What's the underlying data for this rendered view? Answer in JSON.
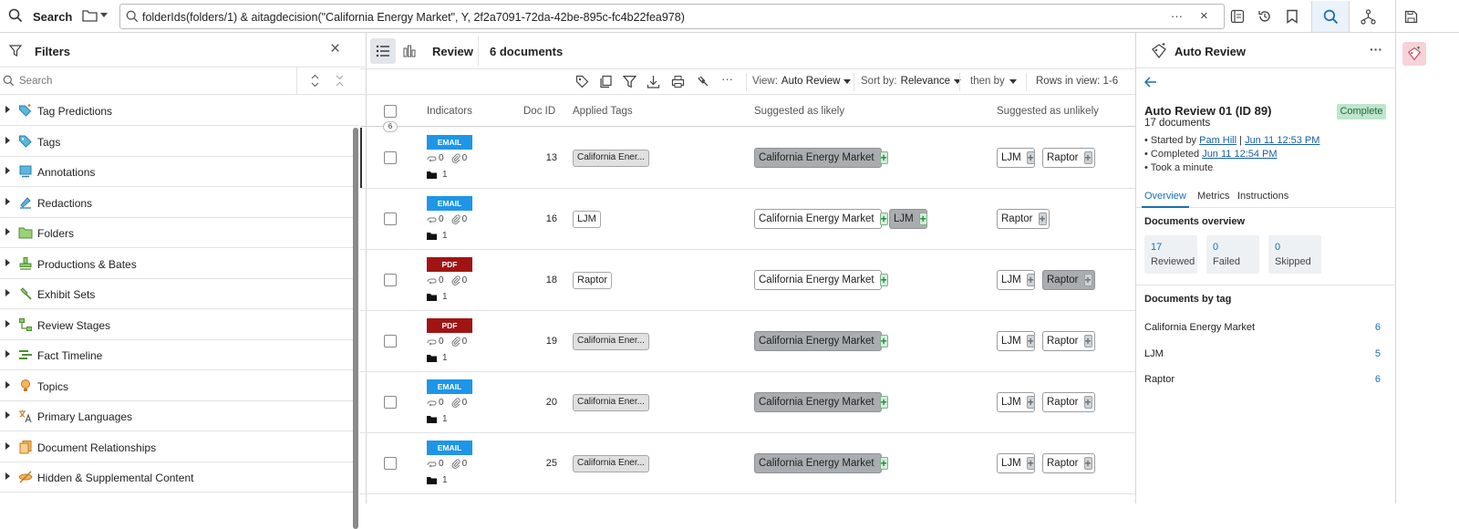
{
  "topbar": {
    "search_label": "Search",
    "query": "folderIds(folders/1) & aitagdecision(\"California Energy Market\", Y, 2f2a7091-72da-42be-895c-fc4b22fea978)",
    "more": "···",
    "clear": "×"
  },
  "filters": {
    "title": "Filters",
    "close": "×",
    "search_placeholder": "Search",
    "items": [
      {
        "label": "Tag Predictions",
        "icon": "tag-prediction-icon"
      },
      {
        "label": "Tags",
        "icon": "tag-icon"
      },
      {
        "label": "Annotations",
        "icon": "annotation-icon"
      },
      {
        "label": "Redactions",
        "icon": "redaction-icon"
      },
      {
        "label": "Folders",
        "icon": "folder-icon"
      },
      {
        "label": "Productions & Bates",
        "icon": "stamp-icon"
      },
      {
        "label": "Exhibit Sets",
        "icon": "gavel-icon"
      },
      {
        "label": "Review Stages",
        "icon": "stages-icon"
      },
      {
        "label": "Fact Timeline",
        "icon": "timeline-icon"
      },
      {
        "label": "Topics",
        "icon": "lightbulb-icon"
      },
      {
        "label": "Primary Languages",
        "icon": "language-icon"
      },
      {
        "label": "Document Relationships",
        "icon": "relationships-icon"
      },
      {
        "label": "Hidden & Supplemental Content",
        "icon": "hidden-icon"
      }
    ]
  },
  "center": {
    "review_label": "Review",
    "doc_count": "6 documents",
    "more": "···",
    "view_label": "View:",
    "view_value": "Auto Review",
    "sort_label": "Sort by:",
    "sort_value": "Relevance",
    "then_by": "then by",
    "rows_in_view": "Rows in view: 1-6",
    "columns": {
      "indicators": "Indicators",
      "doc_id": "Doc ID",
      "applied_tags": "Applied Tags",
      "likely": "Suggested as likely",
      "unlikely": "Suggested as unlikely"
    },
    "header_count": "6",
    "rows": [
      {
        "type": "EMAIL",
        "type_color": "#1e96e8",
        "a": "0",
        "b": "0",
        "folders": "1",
        "doc_id": "13",
        "applied": "California Ener...",
        "applied_grey": true,
        "likely": [
          {
            "label": "California Energy Market",
            "hl": true
          }
        ],
        "unlikely": [
          {
            "label": "LJM",
            "hl": false
          },
          {
            "label": "Raptor",
            "hl": false
          }
        ]
      },
      {
        "type": "EMAIL",
        "type_color": "#1e96e8",
        "a": "0",
        "b": "0",
        "folders": "1",
        "doc_id": "16",
        "applied": "LJM",
        "applied_grey": false,
        "likely": [
          {
            "label": "California Energy Market",
            "hl": false
          },
          {
            "label": "LJM",
            "hl": true
          }
        ],
        "unlikely": [
          {
            "label": "Raptor",
            "hl": false
          }
        ]
      },
      {
        "type": "PDF",
        "type_color": "#a11414",
        "a": "0",
        "b": "0",
        "folders": "1",
        "doc_id": "18",
        "applied": "Raptor",
        "applied_grey": false,
        "likely": [
          {
            "label": "California Energy Market",
            "hl": false
          }
        ],
        "unlikely": [
          {
            "label": "LJM",
            "hl": false
          },
          {
            "label": "Raptor",
            "hl": true
          }
        ]
      },
      {
        "type": "PDF",
        "type_color": "#a11414",
        "a": "0",
        "b": "0",
        "folders": "1",
        "doc_id": "19",
        "applied": "California Ener...",
        "applied_grey": true,
        "likely": [
          {
            "label": "California Energy Market",
            "hl": true
          }
        ],
        "unlikely": [
          {
            "label": "LJM",
            "hl": false
          },
          {
            "label": "Raptor",
            "hl": false
          }
        ]
      },
      {
        "type": "EMAIL",
        "type_color": "#1e96e8",
        "a": "0",
        "b": "0",
        "folders": "1",
        "doc_id": "20",
        "applied": "California Ener...",
        "applied_grey": true,
        "likely": [
          {
            "label": "California Energy Market",
            "hl": true
          }
        ],
        "unlikely": [
          {
            "label": "LJM",
            "hl": false
          },
          {
            "label": "Raptor",
            "hl": false
          }
        ]
      },
      {
        "type": "EMAIL",
        "type_color": "#1e96e8",
        "a": "0",
        "b": "0",
        "folders": "1",
        "doc_id": "25",
        "applied": "California Ener...",
        "applied_grey": true,
        "likely": [
          {
            "label": "California Energy Market",
            "hl": true
          }
        ],
        "unlikely": [
          {
            "label": "LJM",
            "hl": false
          },
          {
            "label": "Raptor",
            "hl": false
          }
        ]
      }
    ]
  },
  "right": {
    "title": "Auto Review",
    "more": "···",
    "review_name": "Auto Review 01 (ID 89)",
    "doc_count": "17 documents",
    "status": "Complete",
    "started_label": "Started by",
    "started_by": "Pam Hill",
    "sep": "|",
    "started_at": "Jun 11 12:53 PM",
    "completed_label": "Completed",
    "completed_at": "Jun 11 12:54 PM",
    "duration": "Took a minute",
    "tabs": [
      "Overview",
      "Metrics",
      "Instructions"
    ],
    "overview_title": "Documents overview",
    "stats": [
      {
        "num": "17",
        "label": "Reviewed"
      },
      {
        "num": "0",
        "label": "Failed"
      },
      {
        "num": "0",
        "label": "Skipped"
      }
    ],
    "by_tag_title": "Documents by tag",
    "by_tag": [
      {
        "tag": "California Energy Market",
        "count": "6"
      },
      {
        "tag": "LJM",
        "count": "5"
      },
      {
        "tag": "Raptor",
        "count": "6"
      }
    ]
  },
  "colors": {
    "accent": "#1a6fb5",
    "email": "#1e96e8",
    "pdf": "#a11414",
    "complete": "#bfe5cc"
  }
}
